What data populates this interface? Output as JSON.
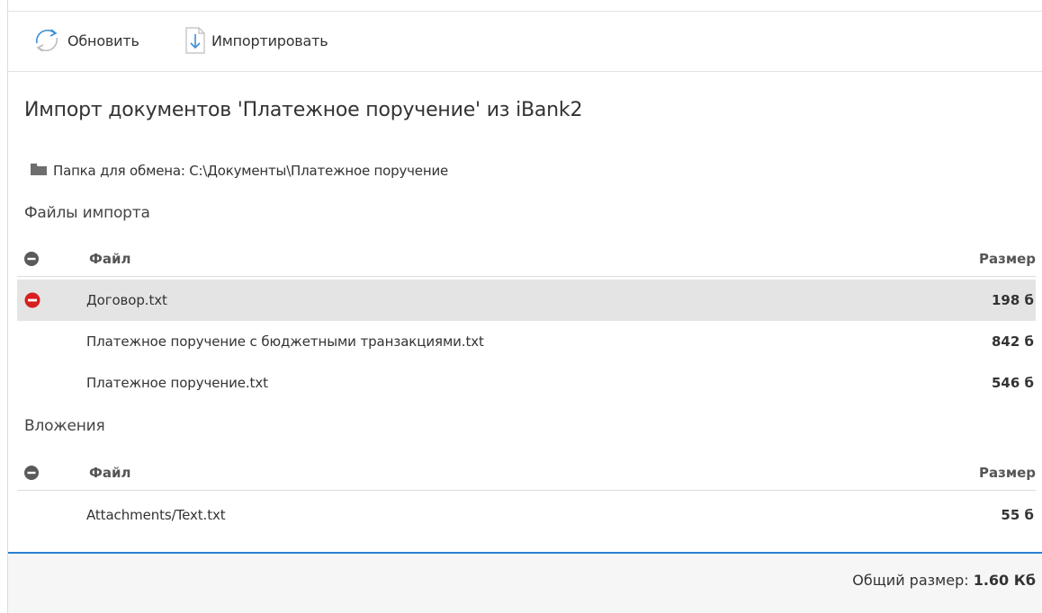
{
  "toolbar": {
    "refresh_label": "Обновить",
    "import_label": "Импортировать"
  },
  "page": {
    "title": "Импорт документов 'Платежное поручение' из iBank2",
    "folder_label": "Папка для обмена: C:\\Документы\\Платежное поручение"
  },
  "import_files": {
    "section_title": "Файлы импорта",
    "header_file": "Файл",
    "header_size": "Размер",
    "rows": [
      {
        "name": "Договор.txt",
        "size": "198 б",
        "selected": true,
        "excluded": true
      },
      {
        "name": "Платежное поручение с бюджетными транзакциями.txt",
        "size": "842 б",
        "selected": false,
        "excluded": false
      },
      {
        "name": "Платежное поручение.txt",
        "size": "546 б",
        "selected": false,
        "excluded": false
      }
    ]
  },
  "attachments": {
    "section_title": "Вложения",
    "header_file": "Файл",
    "header_size": "Размер",
    "rows": [
      {
        "name": "Attachments/Text.txt",
        "size": "55 б"
      }
    ]
  },
  "footer": {
    "total_label": "Общий размер:",
    "total_value": "1.60 Кб"
  },
  "colors": {
    "accent": "#2a7fd4",
    "remove_red": "#d81e1e",
    "header_toggle_gray": "#5a5a5a",
    "selected_row": "#e4e4e4"
  },
  "icons": {
    "refresh": "refresh-icon",
    "import": "import-file-icon",
    "folder": "folder-icon",
    "toggle_header": "minus-circle-icon",
    "remove_row": "remove-circle-icon"
  }
}
